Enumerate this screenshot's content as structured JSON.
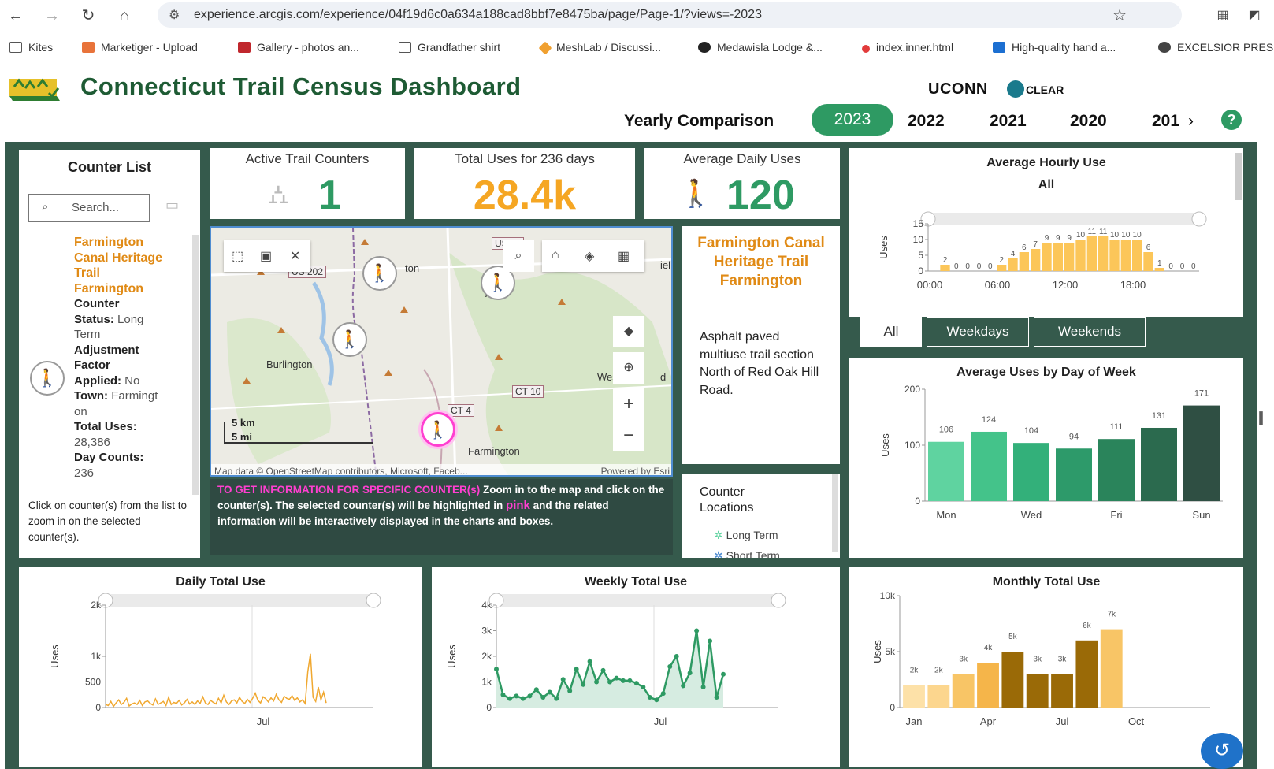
{
  "browser": {
    "url": "experience.arcgis.com/experience/04f19d6c0a634a188cad8bbf7e8475ba/page/Page-1/?views=-2023",
    "bookmarks": [
      "Kites",
      "Marketiger - Upload",
      "Gallery - photos an...",
      "Grandfather shirt",
      "MeshLab / Discussi...",
      "Medawisla Lodge &...",
      "index.inner.html",
      "High-quality hand a...",
      "EXCELSIOR PRES"
    ]
  },
  "header": {
    "title": "Connecticut Trail Census Dashboard",
    "uconn": "UCONN",
    "clear": "CLEAR",
    "yearly_label": "Yearly Comparison",
    "years": [
      "2023",
      "2022",
      "2021",
      "2020",
      "201"
    ],
    "help": "?"
  },
  "stats": {
    "active_label": "Active Trail Counters",
    "active_value": "1",
    "total_label": "Total Uses for 236 days",
    "total_value": "28.4k",
    "avg_label": "Average Daily Uses",
    "avg_value": "120"
  },
  "counter_list": {
    "title": "Counter List",
    "search_placeholder": "Search...",
    "name_lines": [
      "Farmington",
      "Canal Heritage",
      "Trail",
      "Farmington"
    ],
    "type_line": "Counter",
    "status_label": "Status:",
    "status_value1": "Long",
    "status_value2": "Term",
    "adj_label1": "Adjustment",
    "adj_label2": "Factor",
    "adj_label3": "Applied:",
    "adj_value": "No",
    "town_label": "Town:",
    "town_value1": "Farmingt",
    "town_value2": "on",
    "total_label": "Total Uses:",
    "total_value": "28,386",
    "days_label": "Day Counts:",
    "days_value": "236",
    "hint": "Click on counter(s) from the list to zoom in on the selected counter(s)."
  },
  "map": {
    "roads": [
      "US 20",
      "US 202",
      "US",
      "CT 10",
      "CT 4"
    ],
    "towns": [
      "Burlington",
      "West",
      "Farmington",
      "ton",
      "A",
      "iel",
      "d"
    ],
    "scale_km": "5 km",
    "scale_mi": "5 mi",
    "attribution": "Map data © OpenStreetMap contributors, Microsoft, Faceb...",
    "powered": "Powered by Esri",
    "info_highlight": "TO GET INFORMATION FOR SPECIFIC COUNTER(s)",
    "info_rest1": " Zoom in to the map and click on the counter(s). The selected counter(s) will be highlighted in ",
    "info_pink": "pink",
    "info_rest2": " and the related information will be interactively displayed in the charts and boxes."
  },
  "detail": {
    "name": "Farmington Canal Heritage Trail Farmington",
    "description": "Asphalt paved multiuse trail section North of Red Oak Hill Road."
  },
  "locations": {
    "title": "Counter Locations",
    "items": [
      "Long Term",
      "Short Term"
    ]
  },
  "hourly": {
    "title": "Average Hourly Use",
    "subtitle": "All",
    "ylabel": "Uses",
    "yticks": [
      "15",
      "10",
      "5",
      "0"
    ],
    "xticks": [
      "00:00",
      "06:00",
      "12:00",
      "18:00"
    ],
    "tabs": [
      "All",
      "Weekdays",
      "Weekends"
    ]
  },
  "weekday": {
    "title": "Average Uses by Day of Week",
    "ylabel": "Uses",
    "yticks": [
      "200",
      "100",
      "0"
    ],
    "xticks": [
      "Mon",
      "Wed",
      "Fri",
      "Sun"
    ]
  },
  "daily": {
    "title": "Daily Total Use",
    "ylabel": "Uses",
    "yticks": [
      "2k",
      "1k",
      "500",
      "0"
    ],
    "xticks": [
      "Jul"
    ]
  },
  "weekly": {
    "title": "Weekly Total Use",
    "ylabel": "Uses",
    "yticks": [
      "4k",
      "3k",
      "2k",
      "1k",
      "0"
    ],
    "xticks": [
      "Jul"
    ]
  },
  "monthly": {
    "title": "Monthly Total Use",
    "ylabel": "Uses",
    "yticks": [
      "10k",
      "5k",
      "0"
    ],
    "xticks": [
      "Jan",
      "Apr",
      "Jul",
      "Oct"
    ]
  },
  "colors": {
    "green": "#1e5b34",
    "accent": "#2e9a63",
    "orange": "#f5a623",
    "frame": "#355a4c",
    "pink": "#ff3fd0"
  },
  "chart_data": [
    {
      "type": "bar",
      "title": "Average Hourly Use",
      "ylabel": "Uses",
      "ylim": [
        0,
        15
      ],
      "categories": [
        "0",
        "1",
        "2",
        "3",
        "4",
        "5",
        "6",
        "7",
        "8",
        "9",
        "10",
        "11",
        "12",
        "13",
        "14",
        "15",
        "16",
        "17",
        "18",
        "19",
        "20",
        "21",
        "22",
        "23"
      ],
      "values": [
        0,
        2,
        0,
        0,
        0,
        0,
        2,
        4,
        6,
        7,
        9,
        9,
        9,
        10,
        11,
        11,
        10,
        10,
        10,
        6,
        1,
        0,
        0,
        0
      ],
      "labels": [
        "",
        "2",
        "0",
        "0",
        "0",
        "0",
        "2",
        "4",
        "6",
        "7",
        "9",
        "9",
        "9",
        "10",
        "11",
        "11",
        "10",
        "10",
        "10",
        "6",
        "1",
        "0",
        "0",
        "0"
      ]
    },
    {
      "type": "bar",
      "title": "Average Uses by Day of Week",
      "ylabel": "Uses",
      "ylim": [
        0,
        200
      ],
      "categories": [
        "Mon",
        "Tue",
        "Wed",
        "Thu",
        "Fri",
        "Sat",
        "Sun"
      ],
      "values": [
        106,
        124,
        104,
        94,
        111,
        131,
        171
      ],
      "colors": [
        "#5fd3a0",
        "#44c38a",
        "#33b07a",
        "#2d9a6a",
        "#2a845b",
        "#2b6a4e",
        "#2f4f43"
      ]
    },
    {
      "type": "line",
      "title": "Daily Total Use",
      "ylabel": "Uses",
      "ylim": [
        0,
        2000
      ],
      "values": [
        60,
        40,
        120,
        20,
        90,
        150,
        60,
        100,
        180,
        30,
        70,
        90,
        60,
        140,
        40,
        110,
        130,
        80,
        50,
        170,
        60,
        90,
        120,
        40,
        200,
        60,
        100,
        80,
        140,
        50,
        90,
        160,
        70,
        110,
        60,
        130,
        80,
        210,
        90,
        60,
        140,
        100,
        70,
        180,
        90,
        240,
        110,
        60,
        130,
        150,
        90,
        200,
        120,
        80,
        160,
        100,
        180,
        280,
        140,
        90,
        210,
        170,
        110,
        190,
        130,
        260,
        150,
        100,
        220,
        180,
        160,
        230,
        140,
        190,
        110,
        150,
        80,
        700,
        1050,
        200,
        120,
        400,
        150,
        300,
        90
      ]
    },
    {
      "type": "area",
      "title": "Weekly Total Use",
      "ylabel": "Uses",
      "ylim": [
        0,
        4000
      ],
      "values": [
        1500,
        500,
        350,
        450,
        350,
        450,
        700,
        400,
        600,
        350,
        1100,
        650,
        1500,
        900,
        1800,
        1000,
        1450,
        1000,
        1150,
        1050,
        1050,
        950,
        800,
        400,
        300,
        550,
        1600,
        2000,
        850,
        1350,
        3000,
        800,
        2600,
        400,
        1300
      ]
    },
    {
      "type": "bar",
      "title": "Monthly Total Use",
      "ylabel": "Uses",
      "ylim": [
        0,
        10000
      ],
      "categories": [
        "Jan",
        "Feb",
        "Mar",
        "Apr",
        "May",
        "Jun",
        "Jul",
        "Aug",
        "Sep"
      ],
      "values": [
        2000,
        2000,
        3000,
        4000,
        5000,
        3000,
        3000,
        6000,
        7000
      ],
      "labels": [
        "2k",
        "2k",
        "3k",
        "4k",
        "5k",
        "3k",
        "3k",
        "6k",
        "7k"
      ],
      "colors": [
        "#fde1a8",
        "#fcd68e",
        "#f8c566",
        "#f5b54a",
        "#9a6a07",
        "#9a6a07",
        "#9a6a07",
        "#9a6a07",
        "#f8c566"
      ]
    }
  ]
}
